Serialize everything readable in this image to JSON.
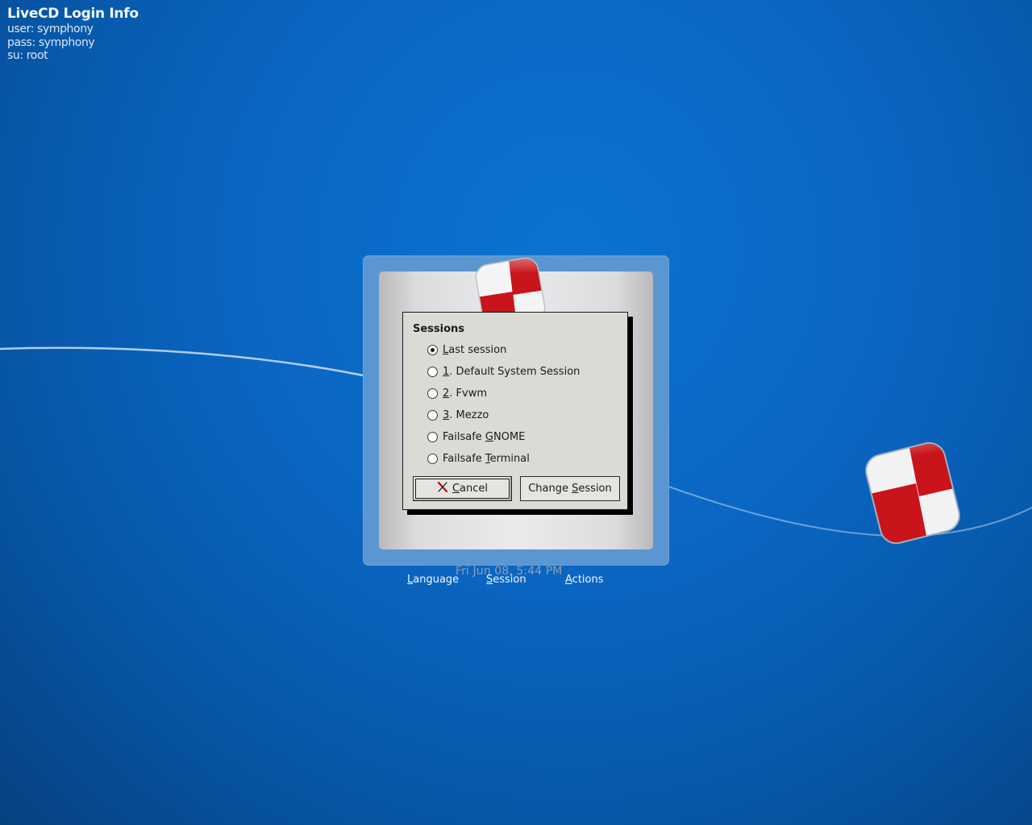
{
  "login_info": {
    "title": "LiveCD Login Info",
    "user": "user: symphony",
    "pass": "pass: symphony",
    "su": "su: root"
  },
  "sessions_dialog": {
    "title": "Sessions",
    "options": [
      {
        "mnemonic": "L",
        "rest": "ast session",
        "prefix": "",
        "checked": true
      },
      {
        "mnemonic": "1",
        "rest": ". Default System Session",
        "prefix": "",
        "checked": false
      },
      {
        "mnemonic": "2",
        "rest": ". Fvwm",
        "prefix": "",
        "checked": false
      },
      {
        "mnemonic": "3",
        "rest": ". Mezzo",
        "prefix": "",
        "checked": false
      },
      {
        "mnemonic": "G",
        "rest": "NOME",
        "prefix": "Failsafe ",
        "checked": false
      },
      {
        "mnemonic": "T",
        "rest": "erminal",
        "prefix": "Failsafe ",
        "checked": false
      }
    ],
    "cancel": {
      "mnemonic": "C",
      "rest": "ancel"
    },
    "change": {
      "prefix": "Change ",
      "mnemonic": "S",
      "rest": "ession"
    }
  },
  "clock": "Fri Jun 08,  5:44 PM",
  "bottom_menu": {
    "language": {
      "mnemonic": "L",
      "rest": "anguage"
    },
    "session": {
      "mnemonic": "S",
      "rest": "ession"
    },
    "actions": {
      "mnemonic": "A",
      "rest": "ctions"
    }
  },
  "icons": {
    "logo": "symphony-checker-logo-icon",
    "cancel": "cancel-x-icon"
  },
  "colors": {
    "logo_red": "#c8141a",
    "desktop_blue": "#0a66c2",
    "dialog_bg": "#dcdad5"
  }
}
